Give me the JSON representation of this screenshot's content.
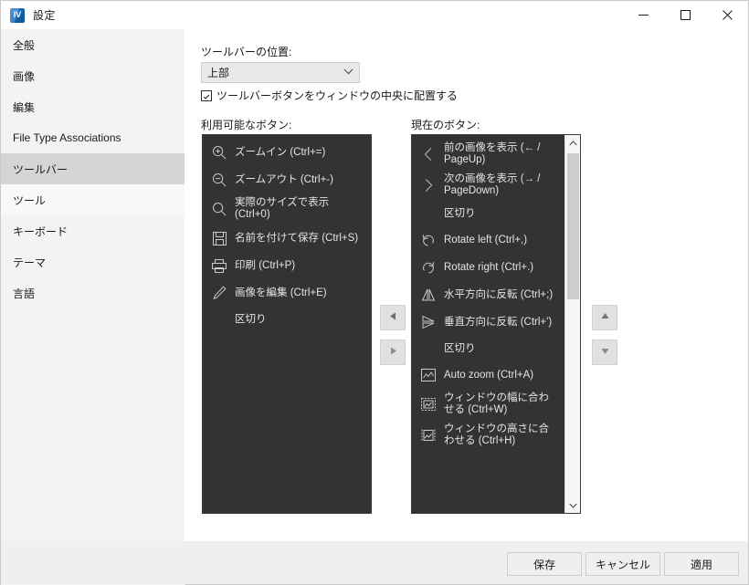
{
  "window": {
    "title": "設定",
    "icon": "app-icon",
    "controls": {
      "minimize": "minimize-icon",
      "maximize": "maximize-icon",
      "close": "close-icon"
    }
  },
  "sidebar": {
    "items": [
      {
        "label": "全般",
        "state": "normal"
      },
      {
        "label": "画像",
        "state": "normal"
      },
      {
        "label": "編集",
        "state": "normal"
      },
      {
        "label": "File Type Associations",
        "state": "normal"
      },
      {
        "label": "ツールバー",
        "state": "selected"
      },
      {
        "label": "ツール",
        "state": "hover"
      },
      {
        "label": "キーボード",
        "state": "normal"
      },
      {
        "label": "テーマ",
        "state": "normal"
      },
      {
        "label": "言語",
        "state": "normal"
      }
    ]
  },
  "main": {
    "position_label": "ツールバーの位置:",
    "position_value": "上部",
    "position_chevron": "chevron-down-icon",
    "center_checkbox_label": "ツールバーボタンをウィンドウの中央に配置する",
    "center_checkbox_checked": true,
    "available_label": "利用可能なボタン:",
    "current_label": "現在のボタン:",
    "available_buttons": [
      {
        "icon": "zoom-in-icon",
        "label": "ズームイン (Ctrl+=)"
      },
      {
        "icon": "zoom-out-icon",
        "label": "ズームアウト (Ctrl+-)"
      },
      {
        "icon": "magnifier-icon",
        "label": "実際のサイズで表示 (Ctrl+0)"
      },
      {
        "icon": "save-as-icon",
        "label": "名前を付けて保存 (Ctrl+S)"
      },
      {
        "icon": "print-icon",
        "label": "印刷 (Ctrl+P)"
      },
      {
        "icon": "edit-image-icon",
        "label": "画像を編集 (Ctrl+E)"
      },
      {
        "icon": "separator-icon",
        "label": "区切り"
      }
    ],
    "current_buttons": [
      {
        "icon": "chevron-left-icon",
        "label": "前の画像を表示 (← / PageUp)"
      },
      {
        "icon": "chevron-right-icon",
        "label": "次の画像を表示 (→ / PageDown)"
      },
      {
        "icon": "separator-icon",
        "label": "区切り"
      },
      {
        "icon": "rotate-left-icon",
        "label": "Rotate left (Ctrl+,)"
      },
      {
        "icon": "rotate-right-icon",
        "label": "Rotate right (Ctrl+.)"
      },
      {
        "icon": "flip-horizontal-icon",
        "label": "水平方向に反転 (Ctrl+;)"
      },
      {
        "icon": "flip-vertical-icon",
        "label": "垂直方向に反転 (Ctrl+')"
      },
      {
        "icon": "separator-icon",
        "label": "区切り"
      },
      {
        "icon": "auto-zoom-icon",
        "label": "Auto zoom (Ctrl+A)"
      },
      {
        "icon": "fit-width-icon",
        "label": "ウィンドウの幅に合わせる (Ctrl+W)"
      },
      {
        "icon": "fit-height-icon",
        "label": "ウィンドウの高さに合わせる (Ctrl+H)"
      }
    ],
    "transfer": {
      "move_left": "arrow-left-icon",
      "move_right": "arrow-right-icon",
      "move_up": "arrow-up-icon",
      "move_down": "arrow-down-icon"
    },
    "scrollbar": {
      "up": "scroll-up-icon",
      "down": "scroll-down-icon"
    }
  },
  "footer": {
    "save": "保存",
    "cancel": "キャンセル",
    "apply": "適用"
  },
  "colors": {
    "list_bg": "#333333",
    "sidebar_bg": "#f3f3f3",
    "selected": "#d5d5d5",
    "footer_bg": "#efefef"
  }
}
